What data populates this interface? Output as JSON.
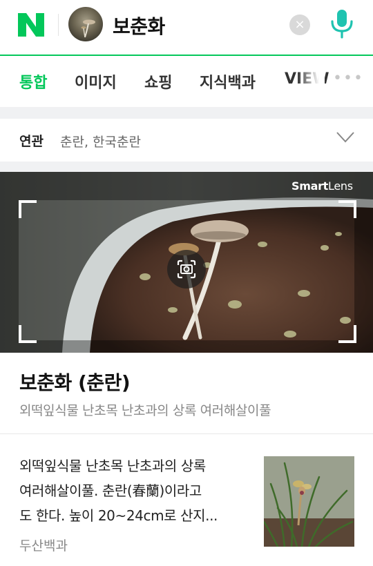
{
  "header": {
    "search_query": "보춘화",
    "clear_label": "×"
  },
  "tabs": [
    {
      "label": "통합",
      "active": true
    },
    {
      "label": "이미지",
      "active": false
    },
    {
      "label": "쇼핑",
      "active": false
    },
    {
      "label": "지식백과",
      "active": false
    },
    {
      "label": "VIEW",
      "active": false
    }
  ],
  "tabs_more_label": "•••",
  "related": {
    "label": "연관",
    "terms": "춘란, 한국춘란"
  },
  "smart_lens": {
    "brand_bold": "Smart",
    "brand_light": "Lens"
  },
  "entity": {
    "title": "보춘화 (춘란)",
    "subtitle": "외떡잎식물 난초목 난초과의 상록 여러해살이풀"
  },
  "description": {
    "lines": [
      "외떡잎식물 난초목 난초과의 상록",
      "여러해살이풀. 춘란(春蘭)이라고",
      "도 한다. 높이 20~24cm로 산지..."
    ],
    "source": "두산백과"
  },
  "colors": {
    "brand_green": "#03c75a",
    "mic_teal": "#1fc3b0"
  }
}
